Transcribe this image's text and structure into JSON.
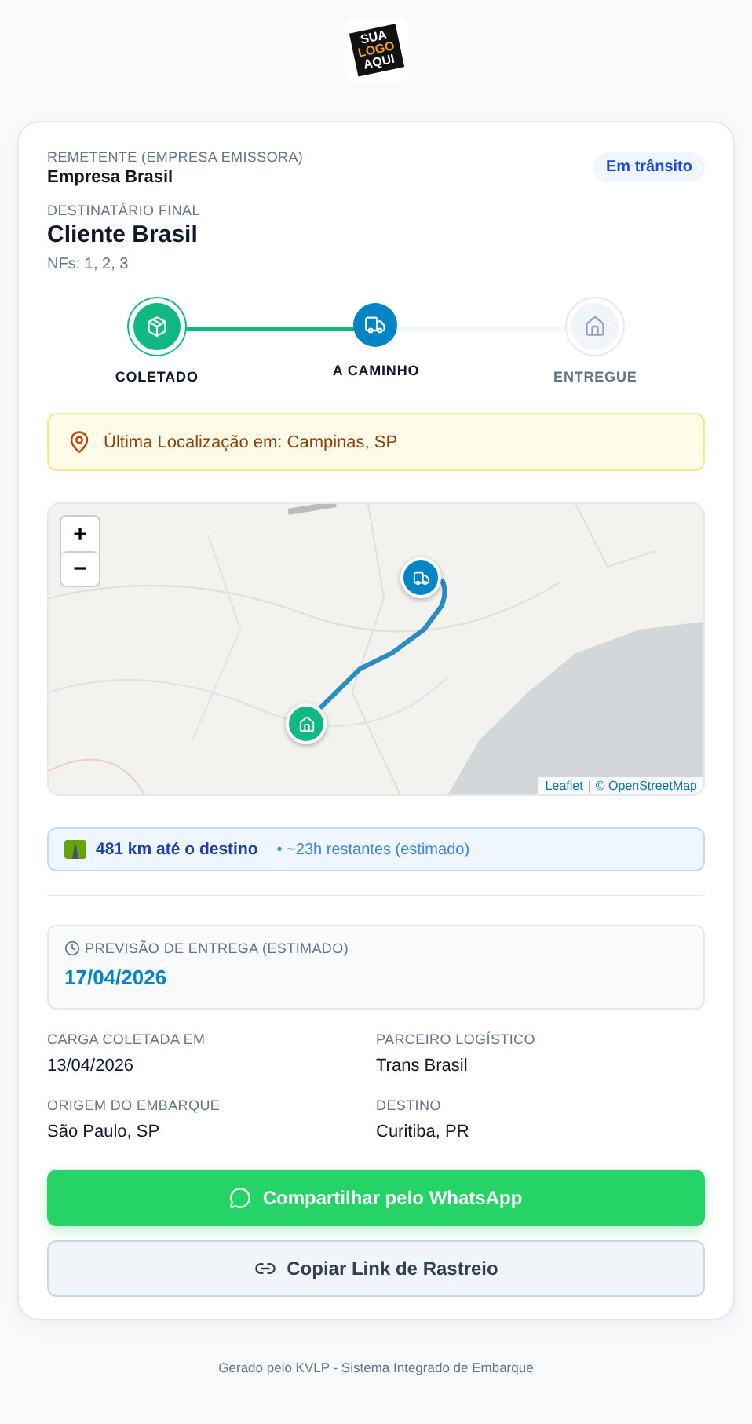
{
  "logo": {
    "lines": [
      "SUA",
      "LOGO",
      "AQUI"
    ]
  },
  "sender": {
    "label": "REMETENTE (EMPRESA EMISSORA)",
    "value": "Empresa Brasil"
  },
  "status_badge": "Em trânsito",
  "recipient": {
    "label": "DESTINATÁRIO FINAL",
    "value": "Cliente Brasil"
  },
  "invoices": "NFs: 1, 2, 3",
  "steps": [
    {
      "label": "COLETADO",
      "kind": "done"
    },
    {
      "label": "A CAMINHO",
      "kind": "current"
    },
    {
      "label": "ENTREGUE",
      "kind": "pending"
    }
  ],
  "location": "Última Localização em: Campinas, SP",
  "map": {
    "zoom_in": "+",
    "zoom_out": "−",
    "attribution": [
      {
        "text": "Leaflet",
        "kind": "link"
      },
      {
        "text": "|",
        "kind": "separator"
      },
      {
        "text": "© OpenStreetMap",
        "kind": "link"
      }
    ]
  },
  "distance": {
    "value": "481 km até o destino",
    "remaining": "• ~23h restantes (estimado)"
  },
  "forecast": {
    "label": "PREVISÃO DE ENTREGA (ESTIMADO)",
    "value": "17/04/2026"
  },
  "details": [
    {
      "label": "CARGA COLETADA EM",
      "value": "13/04/2026"
    },
    {
      "label": "PARCEIRO LOGÍSTICO",
      "value": "Trans Brasil"
    },
    {
      "label": "ORIGEM DO EMBARQUE",
      "value": "São Paulo, SP"
    },
    {
      "label": "DESTINO",
      "value": "Curitiba, PR"
    }
  ],
  "buttons": [
    {
      "label": "Compartilhar pelo WhatsApp",
      "kind": "primary"
    },
    {
      "label": "Copiar Link de Rastreio",
      "kind": "secondary"
    }
  ],
  "footer": "Gerado pelo KVLP - Sistema Integrado de Embarque"
}
